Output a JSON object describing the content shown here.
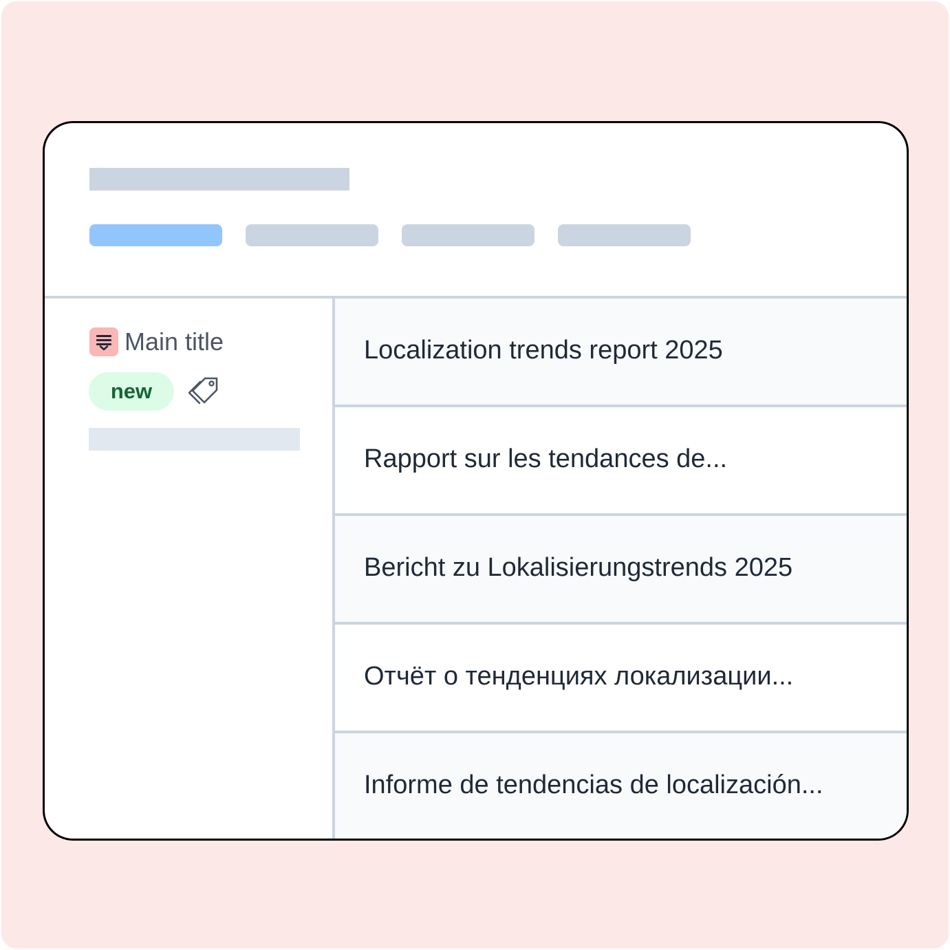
{
  "colors": {
    "backdrop": "#fde8e8",
    "skeleton": "#cbd5e1",
    "active_tab": "#93c5fd",
    "badge_background": "#dcfce7",
    "badge_text": "#166534",
    "title_icon_background": "#fbb6b6"
  },
  "header": {
    "tabs": [
      {
        "state": "active"
      },
      {
        "state": "inactive"
      },
      {
        "state": "inactive"
      },
      {
        "state": "inactive"
      }
    ]
  },
  "sidebar": {
    "title_icon": "list-dropdown-icon",
    "title": "Main title",
    "badge": "new",
    "tag_icon": "tag-icon"
  },
  "translations": [
    {
      "text": "Localization trends report 2025"
    },
    {
      "text": "Rapport sur les tendances de..."
    },
    {
      "text": "Bericht zu Lokalisierungstrends 2025"
    },
    {
      "text": "Отчёт о тенденциях локализации..."
    },
    {
      "text": "Informe de tendencias de localización..."
    }
  ]
}
